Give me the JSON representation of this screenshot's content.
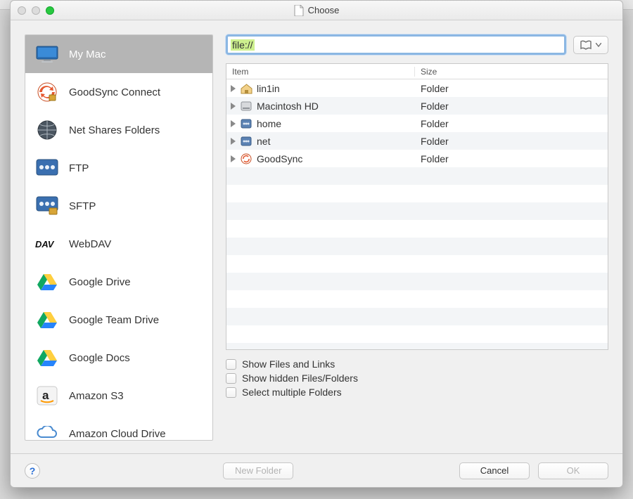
{
  "window": {
    "title": "Choose"
  },
  "path": {
    "value": "file://"
  },
  "sidebar": {
    "items": [
      {
        "label": "My Mac",
        "icon": "monitor-icon",
        "active": true
      },
      {
        "label": "GoodSync Connect",
        "icon": "goodsync-icon",
        "active": false
      },
      {
        "label": "Net Shares Folders",
        "icon": "globe-icon",
        "active": false
      },
      {
        "label": "FTP",
        "icon": "server-icon",
        "active": false
      },
      {
        "label": "SFTP",
        "icon": "server-lock-icon",
        "active": false
      },
      {
        "label": "WebDAV",
        "icon": "webdav-icon",
        "active": false
      },
      {
        "label": "Google Drive",
        "icon": "gdrive-icon",
        "active": false
      },
      {
        "label": "Google Team Drive",
        "icon": "gdrive-icon",
        "active": false
      },
      {
        "label": "Google Docs",
        "icon": "gdrive-icon",
        "active": false
      },
      {
        "label": "Amazon S3",
        "icon": "amazon-icon",
        "active": false
      },
      {
        "label": "Amazon Cloud Drive",
        "icon": "amazon-cloud-icon",
        "active": false
      }
    ]
  },
  "table": {
    "headers": {
      "item": "Item",
      "size": "Size"
    },
    "rows": [
      {
        "name": "lin1in",
        "size": "Folder",
        "icon": "home-icon"
      },
      {
        "name": "Macintosh HD",
        "size": "Folder",
        "icon": "hdd-icon"
      },
      {
        "name": "home",
        "size": "Folder",
        "icon": "volume-icon"
      },
      {
        "name": "net",
        "size": "Folder",
        "icon": "volume-icon"
      },
      {
        "name": "GoodSync",
        "size": "Folder",
        "icon": "goodsync-small-icon"
      }
    ]
  },
  "options": {
    "show_files": "Show Files and Links",
    "show_hidden": "Show hidden Files/Folders",
    "select_multiple": "Select multiple Folders"
  },
  "footer": {
    "new_folder": "New Folder",
    "cancel": "Cancel",
    "ok": "OK"
  }
}
